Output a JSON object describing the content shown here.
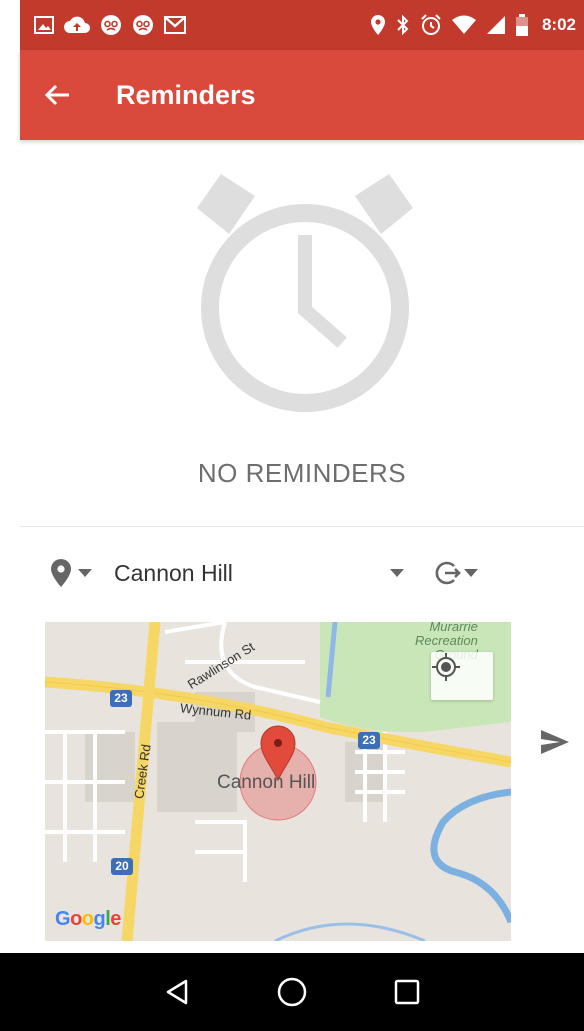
{
  "status_bar": {
    "time": "8:02",
    "left_icons": [
      "image-icon",
      "cloud-upload-icon",
      "face-icon",
      "face-icon",
      "gmail-icon"
    ],
    "right_icons": [
      "location-icon",
      "bluetooth-icon",
      "alarm-icon",
      "wifi-icon",
      "signal-icon",
      "battery-icon"
    ],
    "bg_color": "#c23a2c"
  },
  "app_bar": {
    "title": "Reminders",
    "back_icon": "arrow-back-icon",
    "bg_color": "#d94a3d"
  },
  "empty_state": {
    "icon": "alarm-clock-icon",
    "message": "NO REMINDERS"
  },
  "location_row": {
    "pin_icon": "location-pin-icon",
    "location_name": "Cannon Hill",
    "recurrence_icon": "repeat-icon"
  },
  "map": {
    "place_label": "Cannon Hill",
    "streets": [
      "Rawlinson St",
      "Wynnum Rd",
      "Creek Rd"
    ],
    "park_label_lines": [
      "Murarrie",
      "Recreation",
      "Ground"
    ],
    "route_badges": [
      "23",
      "23",
      "20"
    ],
    "logo_text": "Google"
  },
  "send_icon": "send-icon",
  "nav_bar": {
    "buttons": [
      "back-triangle-icon",
      "home-circle-icon",
      "recents-square-icon"
    ]
  }
}
